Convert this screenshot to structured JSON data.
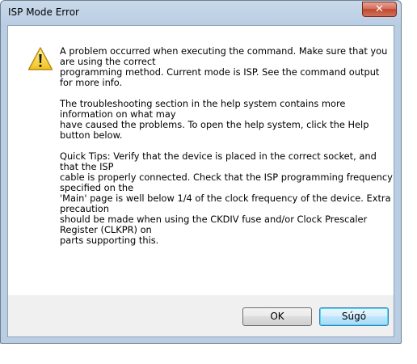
{
  "window": {
    "title": "ISP Mode Error",
    "close_glyph": "✕"
  },
  "icon": "warning-icon",
  "message": {
    "paragraphs": [
      [
        "A problem occurred when executing the command. Make sure that you",
        "are using the correct",
        "programming method. Current mode is ISP. See the command output",
        "for more info."
      ],
      [
        "The troubleshooting section in the help system contains more",
        "information on what may",
        "have caused the problems. To open the help system, click the Help",
        "button below."
      ],
      [
        "Quick Tips: Verify that the device is placed in the correct socket, and",
        "that the ISP",
        "cable is properly connected. Check that the ISP programming frequency",
        "specified on the",
        "'Main' page is well below 1/4 of the clock frequency of the device. Extra",
        "precaution",
        "should be made when using the CKDIV fuse and/or Clock Prescaler",
        "Register (CLKPR) on",
        "parts supporting this."
      ]
    ]
  },
  "buttons": {
    "ok_label": "OK",
    "help_label": "Súgó"
  },
  "colors": {
    "frame": "#b9cde3",
    "close_button": "#c0492f",
    "warning_yellow": "#f6d33c",
    "focus_border": "#3c7fb1"
  }
}
